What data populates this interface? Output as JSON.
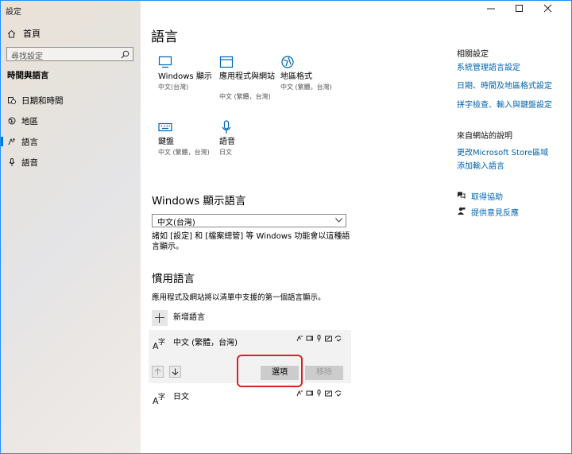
{
  "window": {
    "title": "設定"
  },
  "sidebar": {
    "home": "首頁",
    "search_placeholder": "尋找設定",
    "section": "時間與語言",
    "items": [
      {
        "label": "日期和時間",
        "icon": "calendar-clock-icon"
      },
      {
        "label": "地區",
        "icon": "globe-icon"
      },
      {
        "label": "語言",
        "icon": "language-icon",
        "active": true
      },
      {
        "label": "語音",
        "icon": "microphone-icon"
      }
    ]
  },
  "main": {
    "title": "語言",
    "tiles": [
      {
        "name": "Windows 顯示",
        "desc": "中文(台灣)"
      },
      {
        "name": "應用程式與網站",
        "desc": "中文 (繁體，台灣)"
      },
      {
        "name": "地區格式",
        "desc": "中文 (繁體，台灣)"
      },
      {
        "name": "鍵盤",
        "desc": "中文 (繁體，台灣)"
      },
      {
        "name": "語音",
        "desc": "日文"
      }
    ],
    "display_language": {
      "heading": "Windows 顯示語言",
      "selected": "中文(台灣)",
      "description": "諸如 [設定] 和 [檔案總管] 等 Windows 功能會以這種語言顯示。"
    },
    "preferred": {
      "heading": "慣用語言",
      "description": "應用程式及網站將以清單中支援的第一個語言顯示。",
      "add_label": "新增語言",
      "languages": [
        {
          "name": "中文 (繁體，台灣)"
        },
        {
          "name": "日文"
        }
      ],
      "options_label": "選項",
      "remove_label": "移除"
    }
  },
  "right": {
    "related_heading": "相關設定",
    "related_links": [
      "系統管理語言設定",
      "日期、時間及地區格式設定",
      "拼字檢查、輸入與鍵盤設定"
    ],
    "web_heading": "來自網站的說明",
    "web_links": [
      "更改Microsoft Store區域",
      "添加輸入語言"
    ],
    "get_help": "取得協助",
    "feedback": "提供意見反應"
  }
}
